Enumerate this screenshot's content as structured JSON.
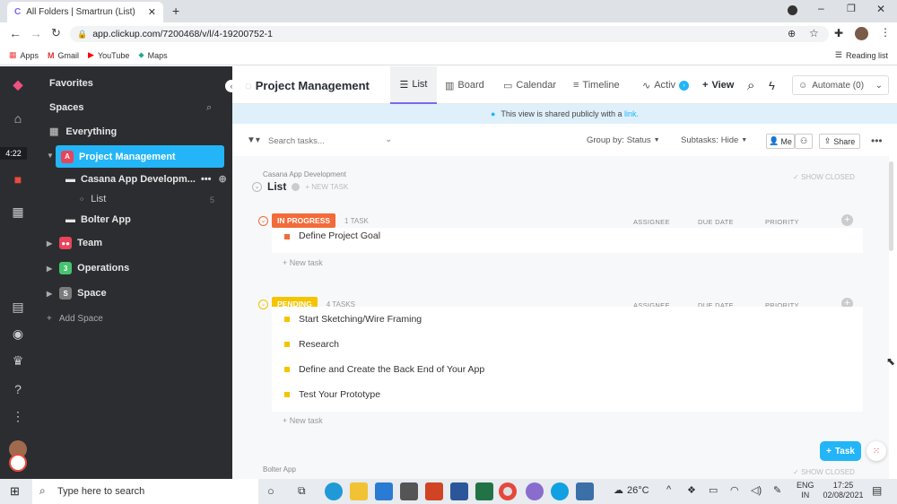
{
  "browser": {
    "tab_title": "All Folders | Smartrun (List)",
    "url": "app.clickup.com/7200468/v/l/4-19200752-1",
    "bookmarks": [
      "Apps",
      "Gmail",
      "YouTube",
      "Maps"
    ],
    "reading_list": "Reading list"
  },
  "rail": {
    "timer": "4:22"
  },
  "sidebar": {
    "favorites": "Favorites",
    "spaces": "Spaces",
    "everything": "Everything",
    "items": [
      {
        "label": "Project Management",
        "badge": "A",
        "color": "#e8445a"
      },
      {
        "label": "Casana App Developm...",
        "sub": true
      },
      {
        "label": "List",
        "count": "5"
      },
      {
        "label": "Bolter App"
      },
      {
        "label": "Team",
        "badge": "●●",
        "color": "#e8445a"
      },
      {
        "label": "Operations",
        "badge": "3",
        "color": "#46c36f"
      },
      {
        "label": "Space",
        "badge": "S",
        "color": "#7b7b7b"
      }
    ],
    "add_space": "Add Space"
  },
  "topnav": {
    "title": "Project Management",
    "tabs": [
      "List",
      "Board",
      "Calendar",
      "Timeline",
      "Activ"
    ],
    "view": "View",
    "automate": "Automate (0)"
  },
  "shared": {
    "text": "This view is shared publicly with a",
    "link": "link."
  },
  "filter": {
    "placeholder": "Search tasks...",
    "group_by": "Group by:",
    "group_val": "Status",
    "subtasks": "Subtasks:",
    "subtasks_val": "Hide",
    "me": "Me",
    "share": "Share"
  },
  "content": {
    "folder": "Casana App Development",
    "list": "List",
    "new_task": "+ NEW TASK",
    "show_closed": "SHOW CLOSED",
    "cols": [
      "ASSIGNEE",
      "DUE DATE",
      "PRIORITY"
    ],
    "groups": [
      {
        "status": "IN PROGRESS",
        "count": "1 TASK",
        "color": "#f26b3a",
        "tasks": [
          "Define Project Goal"
        ]
      },
      {
        "status": "PENDING",
        "count": "4 TASKS",
        "color": "#f5c400",
        "tasks": [
          "Start Sketching/Wire Framing",
          "Research",
          "Define and Create the Back End of Your App",
          "Test Your Prototype"
        ]
      }
    ],
    "add_task": "+ New task",
    "next_folder": "Bolter App",
    "task_button": "Task"
  },
  "taskbar": {
    "search": "Type here to search",
    "temp": "26°C",
    "lang1": "ENG",
    "lang2": "IN",
    "time": "17:25",
    "date": "02/08/2021"
  }
}
